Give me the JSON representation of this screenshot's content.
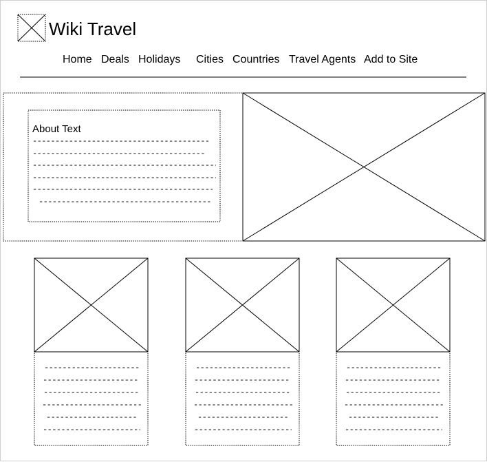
{
  "header": {
    "site_title": "Wiki Travel",
    "nav": [
      "Home",
      "Deals",
      "Holidays",
      "Cities",
      "Countries",
      "Travel Agents",
      "Add to Site"
    ]
  },
  "about": {
    "heading": "About Text",
    "line_count": 6
  },
  "cards": [
    {
      "line_count": 6
    },
    {
      "line_count": 6
    },
    {
      "line_count": 6
    }
  ]
}
